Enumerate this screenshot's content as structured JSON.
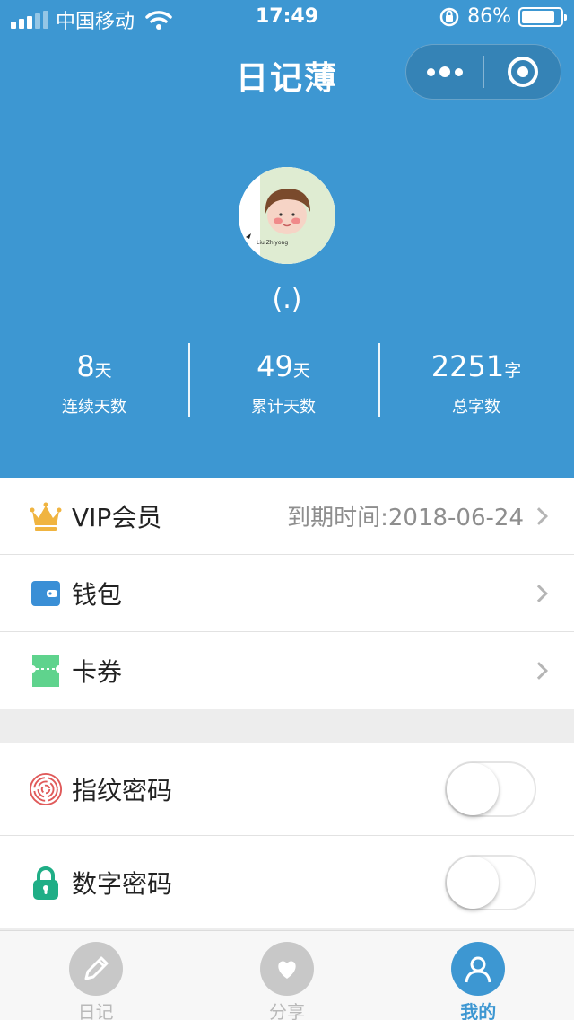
{
  "statusbar": {
    "carrier": "中国移动",
    "time": "17:49",
    "battery": "86%",
    "battery_level": 0.86
  },
  "navbar": {
    "title": "日记薄"
  },
  "profile": {
    "nickname": "(.)",
    "avatar_caption": "Liu Zhiyong"
  },
  "stats": [
    {
      "number": "8",
      "unit": "天",
      "label": "连续天数"
    },
    {
      "number": "49",
      "unit": "天",
      "label": "累计天数"
    },
    {
      "number": "2251",
      "unit": "字",
      "label": "总字数"
    }
  ],
  "menu": {
    "vip": {
      "label": "VIP会员",
      "value": "到期时间:2018-06-24",
      "icon": "crown-icon"
    },
    "wallet": {
      "label": "钱包",
      "icon": "wallet-icon"
    },
    "coupons": {
      "label": "卡券",
      "icon": "ticket-icon"
    }
  },
  "security": {
    "fingerprint": {
      "label": "指纹密码",
      "enabled": false,
      "icon": "fingerprint-icon"
    },
    "pin": {
      "label": "数字密码",
      "enabled": false,
      "icon": "lock-icon"
    }
  },
  "tabbar": [
    {
      "label": "日记",
      "icon": "pencil-icon",
      "active": false
    },
    {
      "label": "分享",
      "icon": "heart-bubble-icon",
      "active": false
    },
    {
      "label": "我的",
      "icon": "user-icon",
      "active": true
    }
  ],
  "colors": {
    "primary": "#3d97d2",
    "vip_gold": "#f0b440",
    "wallet_blue": "#3a8fd6",
    "coupon_green": "#5fd38d",
    "lock_green": "#1fae86",
    "fingerprint_red": "#e05a5a"
  }
}
